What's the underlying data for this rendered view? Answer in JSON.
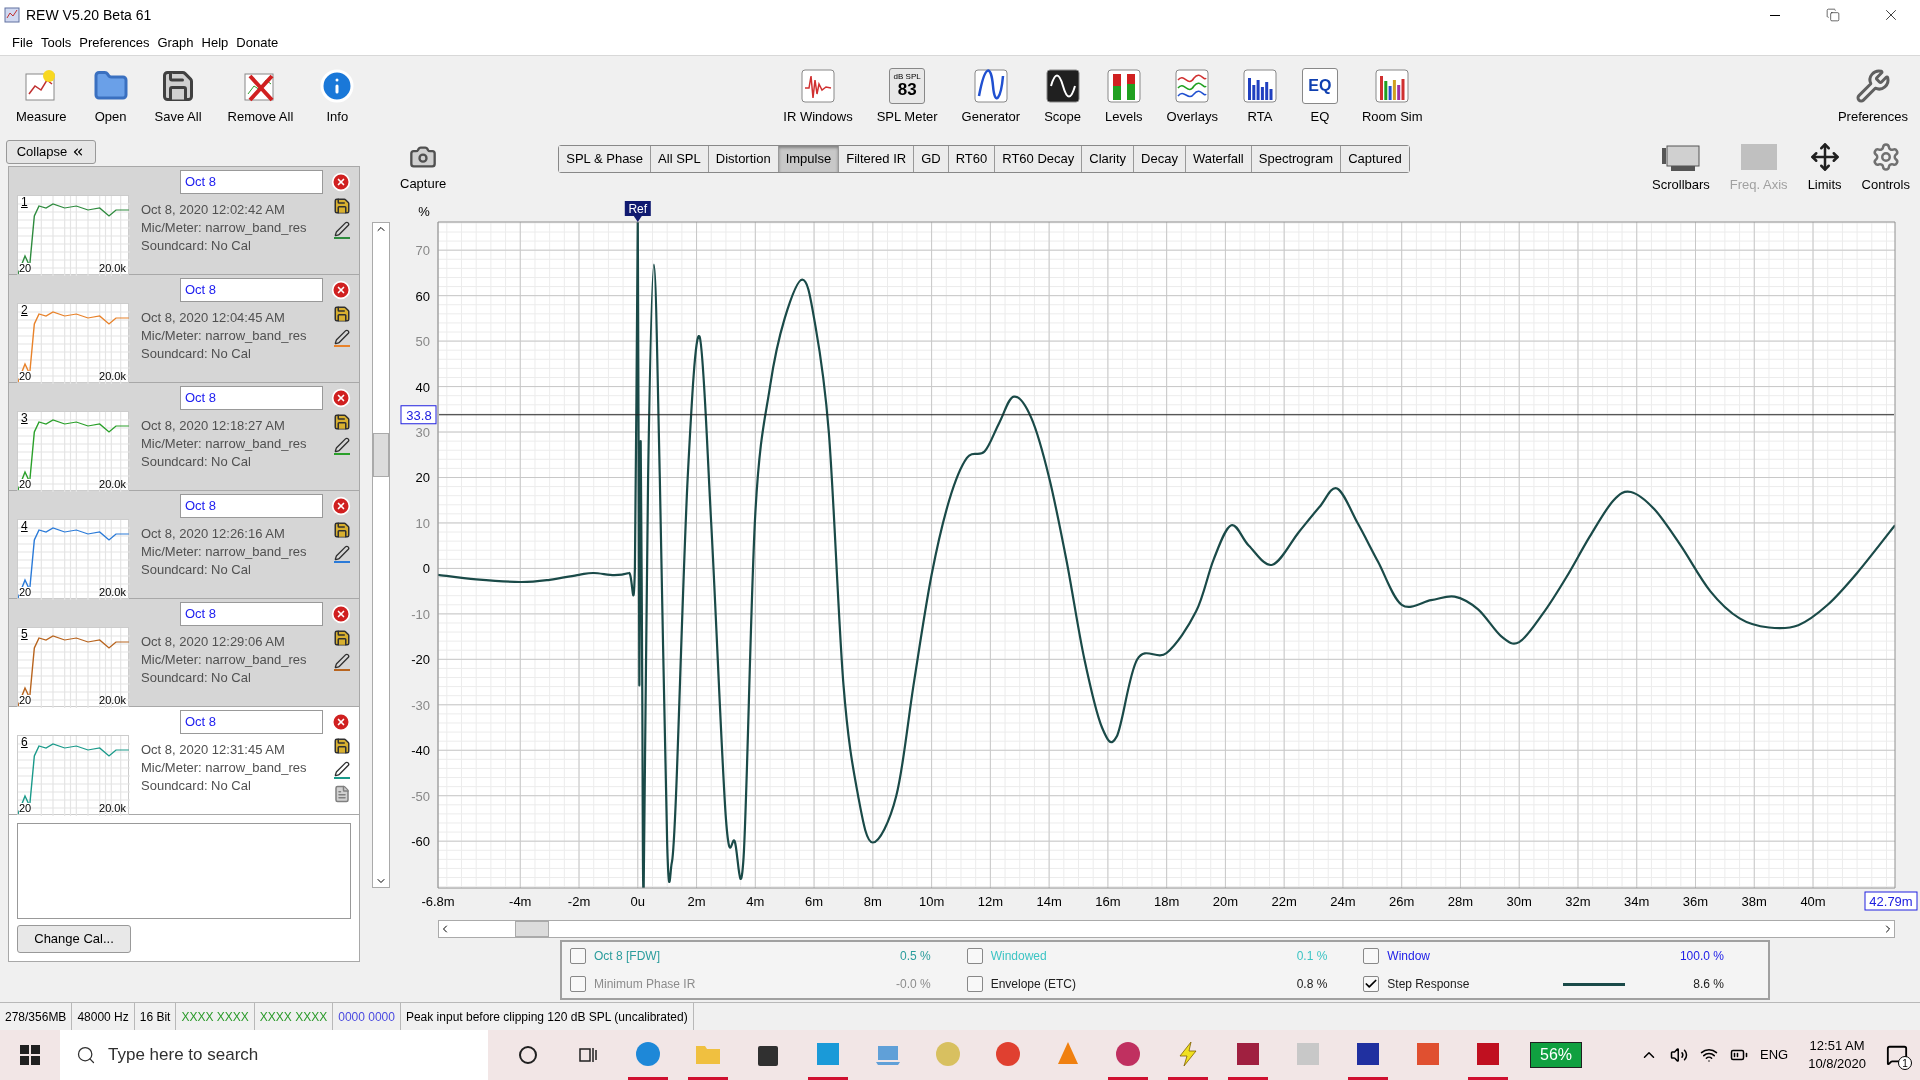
{
  "window": {
    "title": "REW V5.20 Beta 61"
  },
  "menu": [
    "File",
    "Tools",
    "Preferences",
    "Graph",
    "Help",
    "Donate"
  ],
  "toolbar": {
    "left": [
      {
        "label": "Measure",
        "kind": "measure"
      },
      {
        "label": "Open",
        "kind": "open"
      },
      {
        "label": "Save All",
        "kind": "save"
      },
      {
        "label": "Remove All",
        "kind": "remove"
      },
      {
        "label": "Info",
        "kind": "info"
      }
    ],
    "center": [
      {
        "label": "IR Windows",
        "kind": "irwindows"
      },
      {
        "label": "SPL Meter",
        "kind": "spl",
        "badge_top": "dB SPL",
        "badge_value": "83"
      },
      {
        "label": "Generator",
        "kind": "generator"
      },
      {
        "label": "Scope",
        "kind": "scope"
      },
      {
        "label": "Levels",
        "kind": "levels"
      },
      {
        "label": "Overlays",
        "kind": "overlays"
      },
      {
        "label": "RTA",
        "kind": "rta"
      },
      {
        "label": "EQ",
        "kind": "eq",
        "badge_value": "EQ"
      },
      {
        "label": "Room Sim",
        "kind": "roomsim"
      }
    ],
    "right": [
      {
        "label": "Preferences",
        "kind": "prefs"
      }
    ]
  },
  "measurements": {
    "collapse": "Collapse",
    "items": [
      {
        "number": "1",
        "name": "Oct 8",
        "date": "Oct 8, 2020 12:02:42 AM",
        "mic": "Mic/Meter: narrow_band_res",
        "soundcard": "Soundcard: No Cal",
        "axis_min": "20",
        "axis_max": "20.0k",
        "color": "#2e8b3e",
        "selected": false
      },
      {
        "number": "2",
        "name": "Oct 8",
        "date": "Oct 8, 2020 12:04:45 AM",
        "mic": "Mic/Meter: narrow_band_res",
        "soundcard": "Soundcard: No Cal",
        "axis_min": "20",
        "axis_max": "20.0k",
        "color": "#e8822a",
        "selected": false
      },
      {
        "number": "3",
        "name": "Oct 8",
        "date": "Oct 8, 2020 12:18:27 AM",
        "mic": "Mic/Meter: narrow_band_res",
        "soundcard": "Soundcard: No Cal",
        "axis_min": "20",
        "axis_max": "20.0k",
        "color": "#2aa02a",
        "selected": false
      },
      {
        "number": "4",
        "name": "Oct 8",
        "date": "Oct 8, 2020 12:26:16 AM",
        "mic": "Mic/Meter: narrow_band_res",
        "soundcard": "Soundcard: No Cal",
        "axis_min": "20",
        "axis_max": "20.0k",
        "color": "#2a7ad8",
        "selected": false
      },
      {
        "number": "5",
        "name": "Oct 8",
        "date": "Oct 8, 2020 12:29:06 AM",
        "mic": "Mic/Meter: narrow_band_res",
        "soundcard": "Soundcard: No Cal",
        "axis_min": "20",
        "axis_max": "20.0k",
        "color": "#b8641e",
        "selected": false
      },
      {
        "number": "6",
        "name": "Oct 8",
        "date": "Oct 8, 2020 12:31:45 AM",
        "mic": "Mic/Meter: narrow_band_res",
        "soundcard": "Soundcard: No Cal",
        "axis_min": "20",
        "axis_max": "20.0k",
        "color": "#1a9a8a",
        "selected": true
      }
    ],
    "change_cal": "Change Cal..."
  },
  "graph": {
    "capture": "Capture",
    "tabs": [
      {
        "label": "SPL & Phase",
        "selected": false
      },
      {
        "label": "All SPL",
        "selected": false
      },
      {
        "label": "Distortion",
        "selected": false
      },
      {
        "label": "Impulse",
        "selected": true
      },
      {
        "label": "Filtered IR",
        "selected": false
      },
      {
        "label": "GD",
        "selected": false
      },
      {
        "label": "RT60",
        "selected": false
      },
      {
        "label": "RT60 Decay",
        "selected": false
      },
      {
        "label": "Clarity",
        "selected": false
      },
      {
        "label": "Decay",
        "selected": false
      },
      {
        "label": "Waterfall",
        "selected": false
      },
      {
        "label": "Spectrogram",
        "selected": false
      },
      {
        "label": "Captured",
        "selected": false
      }
    ],
    "tools": [
      {
        "label": "Scrollbars",
        "kind": "scrollbars",
        "disabled": false
      },
      {
        "label": "Freq. Axis",
        "kind": "freqaxis",
        "disabled": true
      },
      {
        "label": "Limits",
        "kind": "limits",
        "disabled": false
      },
      {
        "label": "Controls",
        "kind": "controls",
        "disabled": false
      }
    ],
    "chart_data": {
      "type": "line",
      "grid": true,
      "ylabel": "%",
      "ref_lines": [
        {
          "axis": "y",
          "value": 33.8,
          "label": "33.8"
        }
      ],
      "xlim": [
        -6.8,
        42.79
      ],
      "ylim": [
        -70.3,
        76.2
      ],
      "xticks": [
        {
          "value": -6.8,
          "label": "-6.8m"
        },
        {
          "value": -4,
          "label": "-4m"
        },
        {
          "value": -2,
          "label": "-2m"
        },
        {
          "value": 0,
          "label": "0u"
        },
        {
          "value": 2,
          "label": "2m"
        },
        {
          "value": 4,
          "label": "4m"
        },
        {
          "value": 6,
          "label": "6m"
        },
        {
          "value": 8,
          "label": "8m"
        },
        {
          "value": 10,
          "label": "10m"
        },
        {
          "value": 12,
          "label": "12m"
        },
        {
          "value": 14,
          "label": "14m"
        },
        {
          "value": 16,
          "label": "16m"
        },
        {
          "value": 18,
          "label": "18m"
        },
        {
          "value": 20,
          "label": "20m"
        },
        {
          "value": 22,
          "label": "22m"
        },
        {
          "value": 24,
          "label": "24m"
        },
        {
          "value": 26,
          "label": "26m"
        },
        {
          "value": 28,
          "label": "28m"
        },
        {
          "value": 30,
          "label": "30m"
        },
        {
          "value": 32,
          "label": "32m"
        },
        {
          "value": 34,
          "label": "34m"
        },
        {
          "value": 36,
          "label": "36m"
        },
        {
          "value": 38,
          "label": "38m"
        },
        {
          "value": 40,
          "label": "40m"
        }
      ],
      "yticks": [
        -60,
        -50,
        -40,
        -30,
        -20,
        -10,
        0,
        10,
        20,
        30,
        40,
        50,
        60,
        70
      ],
      "x": [
        -6.8,
        -5.5,
        -4,
        -3,
        -2,
        -1.5,
        -0.8,
        -0.3,
        -0.1,
        0,
        0.05,
        0.1,
        0.15,
        0.2,
        0.35,
        0.55,
        0.75,
        1.0,
        1.15,
        1.3,
        1.7,
        2.1,
        2.5,
        3.0,
        3.3,
        3.6,
        4.0,
        4.5,
        5.0,
        5.6,
        6.0,
        6.5,
        7.0,
        7.5,
        8.0,
        8.8,
        9.4,
        10.0,
        10.6,
        11.2,
        11.8,
        12.3,
        12.8,
        13.4,
        14.0,
        14.6,
        15.2,
        15.8,
        16.3,
        17.0,
        18.0,
        19.0,
        19.6,
        20.2,
        20.8,
        21.6,
        22.5,
        23.2,
        23.8,
        24.5,
        25.2,
        26.0,
        27.0,
        27.8,
        28.6,
        29.4,
        30.0,
        30.8,
        31.6,
        32.4,
        33.2,
        33.8,
        34.6,
        35.5,
        36.5,
        37.5,
        38.5,
        39.5,
        40.5,
        41.5,
        42.79
      ],
      "series": [
        {
          "color": "#1a4a48",
          "values": [
            -1.4,
            -2.4,
            -3,
            -2.5,
            -1.4,
            -1,
            -1.5,
            -1,
            0,
            76,
            -25,
            28,
            -24,
            -70,
            20,
            66.8,
            20,
            -60.8,
            -65,
            -50,
            20,
            51,
            10,
            -55,
            -60,
            -63.5,
            12,
            40,
            55,
            63.5,
            55,
            30,
            -25.7,
            -50,
            -60.3,
            -50,
            -25,
            -1.4,
            15,
            24.3,
            25.7,
            32,
            37.8,
            33,
            20,
            1.4,
            -20,
            -35,
            -37,
            -20,
            -18.6,
            -9.5,
            2,
            9.5,
            5,
            0.8,
            8,
            13.5,
            17.6,
            10,
            1.4,
            -8,
            -7,
            -6.2,
            -9,
            -15,
            -16.2,
            -10,
            -2,
            7,
            14.9,
            16.8,
            13,
            5,
            -5,
            -11,
            -13,
            -12.5,
            -8,
            -1,
            9.5
          ]
        }
      ]
    },
    "ref_label": "Ref",
    "cursor_time": "42.79m",
    "legend": [
      {
        "label": "Oct 8 [FDW]",
        "value": "0.5 %",
        "color": "#2a9c9c",
        "checked": false
      },
      {
        "label": "Windowed",
        "value": "0.1 %",
        "color": "#3cc4c4",
        "checked": false
      },
      {
        "label": "Window",
        "value": "100.0 %",
        "color": "#2020e8",
        "checked": false
      },
      {
        "label": "Minimum Phase IR",
        "value": "-0.0 %",
        "color": "#8c8c8c",
        "checked": false
      },
      {
        "label": "Envelope (ETC)",
        "value": "0.8 %",
        "color": "#202020",
        "checked": false
      },
      {
        "label": "Step Response",
        "value": "8.6 %",
        "color": "#202020",
        "checked": true
      }
    ]
  },
  "status_bar": [
    {
      "text": "278/356MB",
      "color": "#000000"
    },
    {
      "text": "48000 Hz",
      "color": "#000000"
    },
    {
      "text": "16 Bit",
      "color": "#000000"
    },
    {
      "text": "XXXX XXXX",
      "color": "#2a9a2a"
    },
    {
      "text": "XXXX XXXX",
      "color": "#2a9a2a"
    },
    {
      "text": "0000 0000",
      "color": "#4a4ae0"
    },
    {
      "text": "Peak input before clipping 120 dB SPL (uncalibrated)",
      "color": "#000000"
    }
  ],
  "taskbar": {
    "search_placeholder": "Type here to search",
    "apps": [
      {
        "kind": "circle",
        "color": "#1e88d8",
        "running": true
      },
      {
        "kind": "folder",
        "color": "#f0c040",
        "running": true
      },
      {
        "kind": "bag",
        "color": "#303030",
        "running": false
      },
      {
        "kind": "square",
        "color": "#1a9ad8",
        "running": true
      },
      {
        "kind": "screen",
        "color": "#60a0d8",
        "running": false
      },
      {
        "kind": "circle",
        "color": "#d8c060",
        "running": false
      },
      {
        "kind": "circle",
        "color": "#e04030",
        "running": false
      },
      {
        "kind": "cone",
        "color": "#f08010",
        "running": false
      },
      {
        "kind": "circle",
        "color": "#c03060",
        "running": true
      },
      {
        "kind": "bolt",
        "color": "#f0e020",
        "running": true
      },
      {
        "kind": "square",
        "color": "#a02040",
        "running": true
      },
      {
        "kind": "square",
        "color": "#c8c8c8",
        "running": false
      },
      {
        "kind": "square",
        "color": "#2030a0",
        "running": true
      },
      {
        "kind": "square",
        "color": "#e05030",
        "running": false
      },
      {
        "kind": "square",
        "color": "#c01020",
        "running": true
      }
    ],
    "battery": "56%",
    "language": "ENG",
    "time": "12:51 AM",
    "date": "10/8/2020",
    "notifications": "1"
  }
}
